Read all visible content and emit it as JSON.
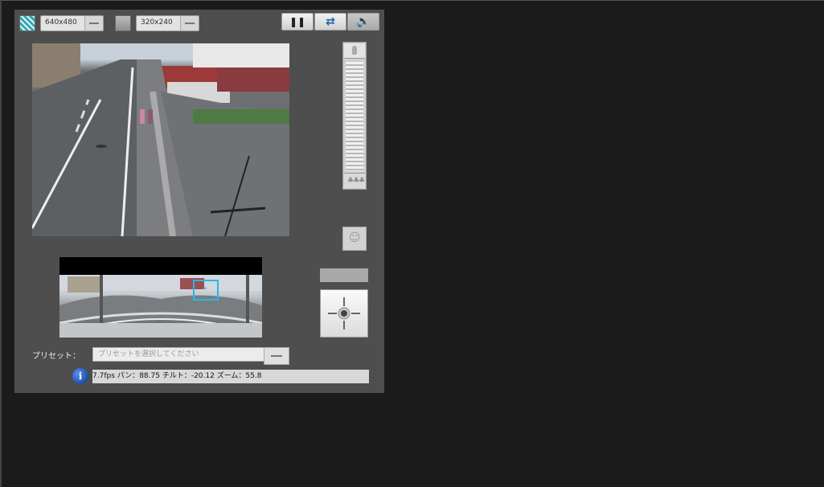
{
  "toolbar": {
    "resolution_large": "640x480",
    "resolution_small": "320x240",
    "pause_icon": "pause-icon",
    "swap_icon": "swap-arrows-icon",
    "speaker_icon": "speaker-icon"
  },
  "zoom": {
    "top_icon": "zoom-in-tree-icon",
    "bottom_icon": "zoom-out-trees-icon"
  },
  "snapshot_icon": "camera-person-icon",
  "ptz_icon": "crosshair-icon",
  "preset": {
    "label": "プリセット：",
    "placeholder": "プリセットを選択してください"
  },
  "status": {
    "text": "7.7fps パン：88.75 チルト：-20.12 ズーム：55.8"
  },
  "colors": {
    "panel_bg": "#4e4e4e",
    "page_bg": "#1b1b1b",
    "selection_box": "#29b6e8",
    "info_icon": "#1f4fa8"
  }
}
